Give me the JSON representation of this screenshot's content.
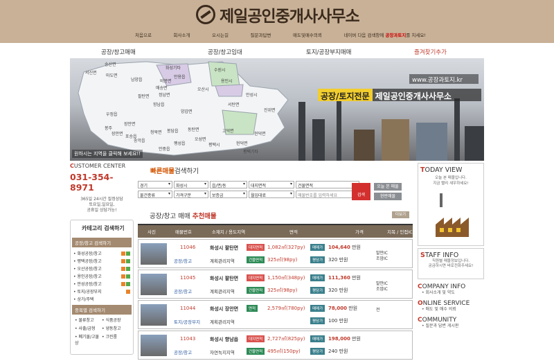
{
  "header": {
    "logo_text": "제일공인중개사사무소"
  },
  "subnav": [
    {
      "label": "처음으로"
    },
    {
      "label": "회사소개"
    },
    {
      "label": "오시는길"
    },
    {
      "label": "질문과답변"
    },
    {
      "label": "매도및매수의뢰"
    },
    {
      "label": "네이버 다음 검색창에 ",
      "highlight": "공장과토지",
      "suffix": "를 치세요!"
    }
  ],
  "mainnav": [
    "공장/창고매매",
    "공장/창고임대",
    "토지/공장부지매매",
    "즐겨찾기추가"
  ],
  "hero": {
    "url": "www.공장과토지.kr",
    "badge": "공장/토지전문",
    "name": "제일공인중개사사무소",
    "note": "원하시는 지역을 클릭해 보세요!!",
    "regions": [
      "송산면",
      "서신면",
      "마도면",
      "남양읍",
      "화성기타",
      "비봉면",
      "매송면",
      "안용읍",
      "수원시",
      "오산시",
      "용인시",
      "정남면",
      "팔탄면",
      "향남읍",
      "양감면",
      "우정읍",
      "장안면",
      "봉담읍",
      "동탄면",
      "안성시",
      "봉주",
      "서탄면",
      "진위면",
      "평택시",
      "고덕면",
      "오성면",
      "현덕면",
      "팽성읍",
      "송악읍",
      "안중읍",
      "장안면",
      "청북면",
      "포승읍",
      "현덕면",
      "평택기타"
    ]
  },
  "customer": {
    "title_first": "C",
    "title_rest": "USTOMER CENTER",
    "phone": "031-354-8971",
    "hours_1": "365일 24시간 질정상담",
    "hours_2": "토요일,일요일,",
    "hours_3": "공휴일 상담가능!"
  },
  "category": {
    "title": "카테고리 검색하기",
    "sec1": "공장/창고 검색하기",
    "items1": [
      "화성공장/창고",
      "평택공장/창고",
      "오산공장/창고",
      "용인공장/창고",
      "안성공장/창고",
      "토지/공장부지",
      "상가/주택"
    ],
    "sec2": "종목별 검색하기",
    "items2": [
      "물류창고",
      "식품공장",
      "사출/금형",
      "냉동창고",
      "폐기물/고물상",
      "크린룸"
    ]
  },
  "quick": {
    "title_hl": "빠른매물",
    "title_rest": "검색하기",
    "row1": [
      "경기",
      "화성시",
      "읍/면/동",
      "대지면적",
      "건물면적"
    ],
    "row2": [
      "물건종류",
      "가격구분",
      "보증금",
      "월임대료"
    ],
    "placeholder": "매물번호를 입력하세요",
    "search": "검색",
    "today_btn": "오늘 본 매물",
    "del_btn": "현판매물"
  },
  "recommend": {
    "title": "공장/창고 매매",
    "title_hl": "추천매물",
    "more": "더보기"
  },
  "table": {
    "cols": [
      "사진",
      "매물번호",
      "소재지 / 용도지역",
      "면적",
      "가격",
      "지목 / 인접IC"
    ]
  },
  "listings": [
    {
      "id": "11046",
      "cat": "공장/창고",
      "loc": "화성시 팔탄면",
      "zone": "계획관리지역",
      "tag1": "대지면적",
      "v1": "1,082㎡(327py)",
      "tag2": "건물면적",
      "v2": "325㎡(98py)",
      "ptag1": "매매가",
      "p1": "104,640",
      "u1": "만원",
      "ptag2": "평당가",
      "p2": "320",
      "u2": "만원",
      "ic": "발안IC",
      "ic2": "조암IC"
    },
    {
      "id": "11045",
      "cat": "공장/창고",
      "loc": "화성시 팔탄면",
      "zone": "계획관리지역",
      "tag1": "대지면적",
      "v1": "1,150㎡(348py)",
      "tag2": "건물면적",
      "v2": "325㎡(98py)",
      "ptag1": "매매가",
      "p1": "111,360",
      "u1": "만원",
      "ptag2": "평당가",
      "p2": "320",
      "u2": "만원",
      "ic": "발안IC",
      "ic2": "조암IC"
    },
    {
      "id": "11044",
      "cat": "토지/공장부지",
      "loc": "화성시 장안면",
      "zone": "계획관리지역",
      "tag1": "면적",
      "v1": "2,579㎡(780py)",
      "tag2": "",
      "v2": "",
      "ptag1": "매매가",
      "p1": "78,000",
      "u1": "만원",
      "ptag2": "평당가",
      "p2": "100",
      "u2": "만원",
      "ic": "전",
      "ic2": ""
    },
    {
      "id": "11043",
      "cat": "공장/창고",
      "loc": "화성시 향남읍",
      "zone": "자연녹지지역",
      "tag1": "대지면적",
      "v1": "2,727㎡(825py)",
      "tag2": "건물면적",
      "v2": "495㎡(150py)",
      "ptag1": "매매가",
      "p1": "198,000",
      "u1": "만원",
      "ptag2": "평당가",
      "p2": "240",
      "u2": "만원",
      "ic": "",
      "ic2": ""
    }
  ],
  "right": {
    "today_first": "T",
    "today_rest": "ODAY VIEW",
    "today_s1": "오늘 본 매물입니다.",
    "today_s2": "지금 빨리 새우하세요!",
    "staff_first": "S",
    "staff_rest": "TAFF INFO",
    "staff_s1": "직원별 매물정보입니다.",
    "staff_s2": "궁금하시면 바로전화주세요!",
    "co_first": "C",
    "co_rest": "OMPANY INFO",
    "co_s": "• 회사소개 및 약도",
    "on_first": "O",
    "on_rest": "NLINE SERVICE",
    "on_s": "• 매도 및 매수 의뢰",
    "cm_first": "C",
    "cm_rest": "OMMUNITY",
    "cm_s": "• 질문과 답변 게시판"
  },
  "colors": {
    "header_bg": "#c8b197",
    "accent_red": "#c0392b",
    "tag_red": "#d9534f",
    "tag_green": "#2e8b57",
    "tag_teal": "#3a7f8c"
  }
}
